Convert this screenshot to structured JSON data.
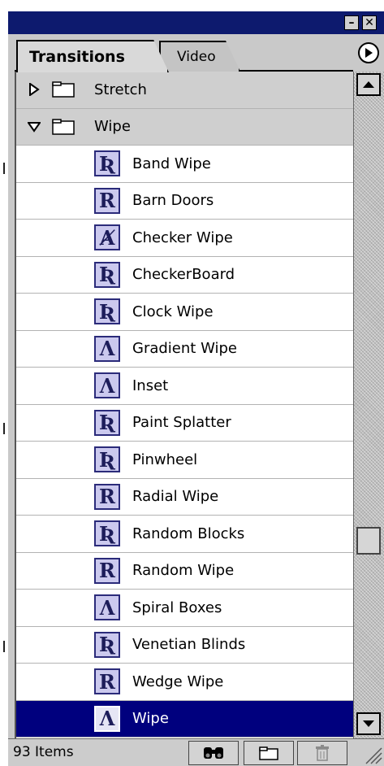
{
  "window": {
    "minimize_glyph": "–",
    "close_glyph": "✕"
  },
  "tabs": [
    {
      "label": "Transitions",
      "active": true
    },
    {
      "label": "Video",
      "active": false
    }
  ],
  "folders": {
    "stretch": {
      "label": "Stretch",
      "expanded": false
    },
    "wipe": {
      "label": "Wipe",
      "expanded": true
    }
  },
  "wipe_items": [
    {
      "label": "Band Wipe",
      "icon_glyph": "Ʀ"
    },
    {
      "label": "Barn Doors",
      "icon_glyph": "R"
    },
    {
      "label": "Checker Wipe",
      "icon_glyph": "Ⱥ"
    },
    {
      "label": "CheckerBoard",
      "icon_glyph": "Ʀ"
    },
    {
      "label": "Clock Wipe",
      "icon_glyph": "Ʀ"
    },
    {
      "label": "Gradient Wipe",
      "icon_glyph": "Λ"
    },
    {
      "label": "Inset",
      "icon_glyph": "Ʌ"
    },
    {
      "label": "Paint Splatter",
      "icon_glyph": "Ʀ"
    },
    {
      "label": "Pinwheel",
      "icon_glyph": "Ʀ"
    },
    {
      "label": "Radial Wipe",
      "icon_glyph": "R"
    },
    {
      "label": "Random Blocks",
      "icon_glyph": "Ʀ"
    },
    {
      "label": "Random Wipe",
      "icon_glyph": "R"
    },
    {
      "label": "Spiral Boxes",
      "icon_glyph": "Ʌ"
    },
    {
      "label": "Venetian Blinds",
      "icon_glyph": "Ʀ"
    },
    {
      "label": "Wedge Wipe",
      "icon_glyph": "R"
    },
    {
      "label": "Wipe",
      "icon_glyph": "Ʌ",
      "selected": true
    }
  ],
  "status": {
    "items_count": "93 Items"
  },
  "scrollbar": {
    "position_fraction": 0.72
  },
  "colors": {
    "title_bar": "#0d1a6e",
    "selection": "#00007e",
    "icon_fill": "#cbc9ee"
  },
  "icons": {
    "find": "binoculars-icon",
    "new_bin": "new-folder-icon",
    "delete": "trash-icon",
    "palette_menu": "right-arrow-circle-icon"
  }
}
